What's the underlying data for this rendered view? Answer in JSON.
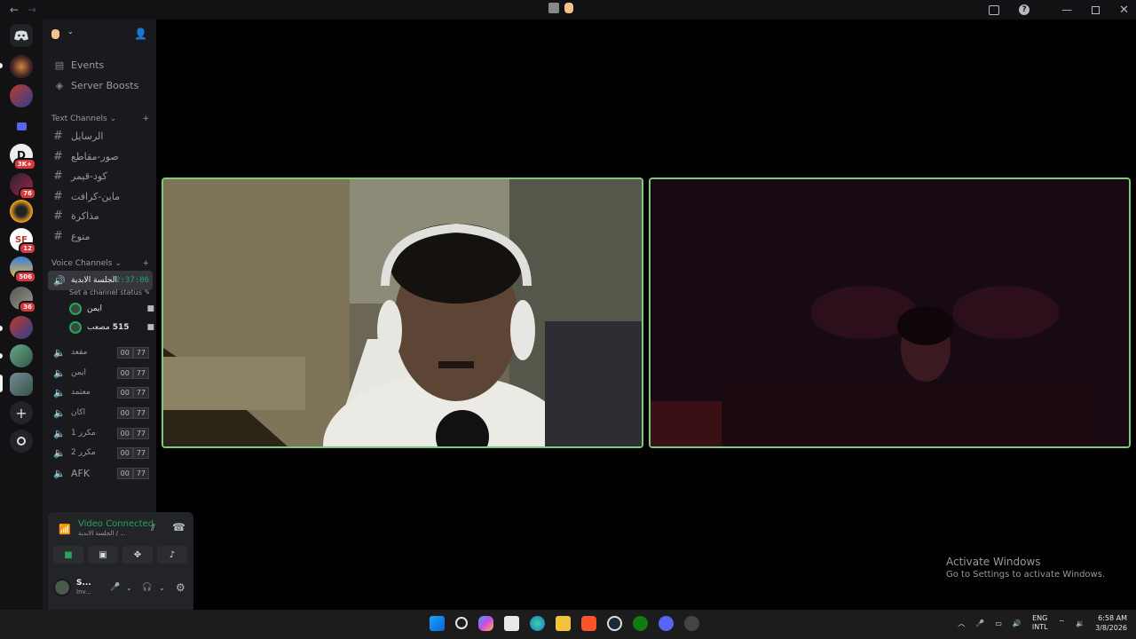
{
  "titlebar": {
    "back": "←",
    "forward": "→"
  },
  "sidebar": {
    "events": "Events",
    "boosts": "Server Boosts",
    "text_category": "Text Channels",
    "text_channels": [
      "الرسايل",
      "صور-مقاطع",
      "كود-قيمر",
      "ماين-كرافت",
      "مذاكرة",
      "متوع"
    ],
    "voice_category": "Voice Channels",
    "active_voice": {
      "name": "الجلسة الابدية",
      "timer": "2:37:06",
      "status": "Set a channel status"
    },
    "voice_users": [
      {
        "name": "ايمن"
      },
      {
        "name": "مصعب",
        "extra": "515"
      }
    ],
    "voice_channels": [
      {
        "name": "مقعد",
        "left": "00",
        "right": "77"
      },
      {
        "name": "ايمن",
        "left": "00",
        "right": "77"
      },
      {
        "name": "معتمد",
        "left": "00",
        "right": "77"
      },
      {
        "name": "اكان",
        "left": "00",
        "right": "77"
      },
      {
        "name": "1 مكرر",
        "left": "00",
        "right": "77"
      },
      {
        "name": "2 مكرر",
        "left": "00",
        "right": "77"
      },
      {
        "name": "AFK",
        "left": "00",
        "right": "77"
      }
    ]
  },
  "servers": {
    "badges": [
      "3K+",
      "76",
      "12",
      "506",
      "36"
    ]
  },
  "voice_panel": {
    "title": "Video Connected",
    "subtitle": "الجلسة الابدية / ...",
    "user": "S...",
    "user_status": "Inv..."
  },
  "activate": {
    "line1": "Activate Windows",
    "line2": "Go to Settings to activate Windows."
  },
  "tray": {
    "lang1": "ENG",
    "lang2": "INTL",
    "time": "6:58 AM",
    "date": "3/8/2026"
  }
}
